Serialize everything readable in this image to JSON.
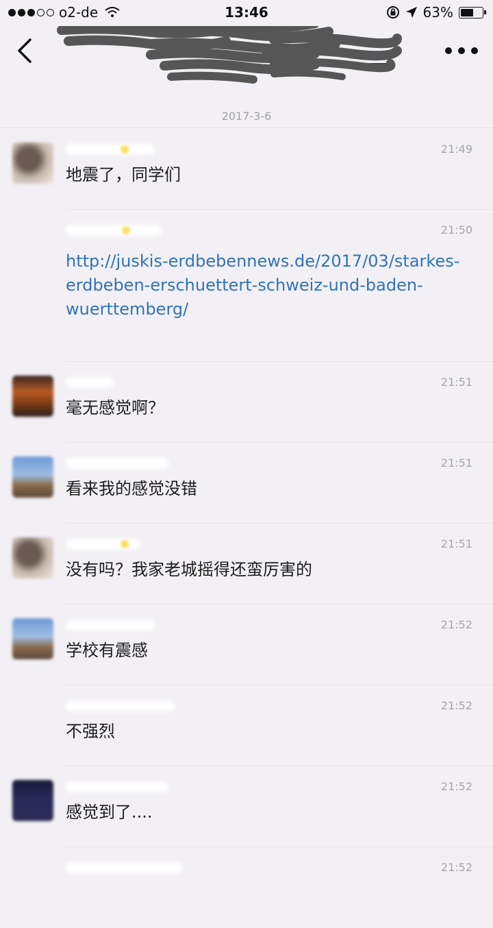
{
  "status_bar": {
    "carrier": "o2-de",
    "time": "13:46",
    "battery": "63%",
    "battery_level_percent": 63
  },
  "nav": {
    "title_redacted": true
  },
  "date_divider": "2017-3-6",
  "messages": [
    {
      "time": "21:49",
      "text": "地震了，同学们",
      "avatar_style": "av-1",
      "has_avatar": true
    },
    {
      "time": "21:50",
      "link": "http://juskis-erdbebennews.de/2017/03/starkes-erdbeben-erschuettert-schweiz-und-baden-wuerttemberg/",
      "has_avatar": false
    },
    {
      "time": "21:51",
      "text": "毫无感觉啊？",
      "avatar_style": "av-2",
      "has_avatar": true
    },
    {
      "time": "21:51",
      "text": "看来我的感觉没错",
      "avatar_style": "av-3",
      "has_avatar": true
    },
    {
      "time": "21:51",
      "text": "没有吗？我家老城摇得还蛮厉害的",
      "avatar_style": "av-1",
      "has_avatar": true
    },
    {
      "time": "21:52",
      "text": "学校有震感",
      "avatar_style": "av-3",
      "has_avatar": true
    },
    {
      "time": "21:52",
      "text": "不强烈",
      "has_avatar": false
    },
    {
      "time": "21:52",
      "text": "感觉到了....",
      "avatar_style": "av-4",
      "has_avatar": true
    },
    {
      "time": "21:52",
      "text": "",
      "has_avatar": false
    }
  ],
  "icons": {
    "back": "chevron-left-icon",
    "more": "more-dots-icon",
    "wifi": "wifi-icon",
    "lock": "rotation-lock-icon",
    "location": "location-arrow-icon",
    "battery": "battery-icon"
  }
}
